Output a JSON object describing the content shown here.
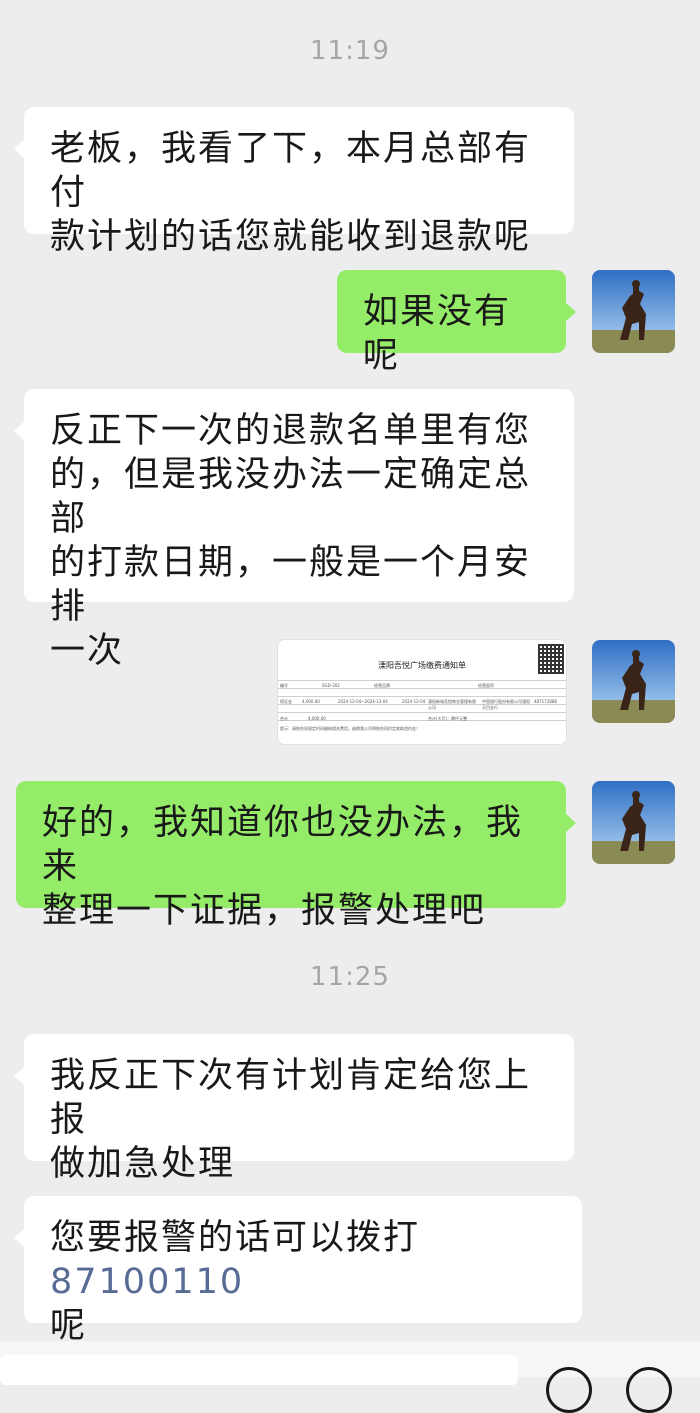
{
  "timestamps": [
    "11:19",
    "11:25"
  ],
  "messages": [
    {
      "side": "left",
      "text_lines": [
        "老板，我看了下，本月总部有付",
        "款计划的话您就能收到退款呢"
      ]
    },
    {
      "side": "right",
      "text_lines": [
        "如果没有呢"
      ]
    },
    {
      "side": "left",
      "text_lines": [
        "反正下一次的退款名单里有您",
        "的，但是我没办法一定确定总部",
        "的打款日期，一般是一个月安排",
        "一次"
      ]
    },
    {
      "side": "right",
      "type": "image",
      "image": {
        "title": "溧阳吾悦广场缴费通知单",
        "cells": [
          "编号",
          "SGD-302",
          "经营品牌",
          "经营面积",
          "保证金",
          "4,000.00",
          "2024-12-04~2024-12-04",
          "2024-12-04",
          "溧阳新城吾悦商业管理有限公司",
          "中国银行股份有限公司溧阳天目支行",
          "487172888",
          "合计",
          "4,000.00",
          "合计(大写)：肆仟元整",
          "提示：请按合同规定时间缴纳相关费用，逾期我公司将按合同约定收取违约金！"
        ]
      }
    },
    {
      "side": "right",
      "text_lines": [
        "好的，我知道你也没办法，我来",
        "整理一下证据，报警处理吧"
      ]
    },
    {
      "side": "left",
      "text_lines": [
        "我反正下次有计划肯定给您上报",
        "做加急处理"
      ]
    },
    {
      "side": "left",
      "text_lines": [
        "您要报警的话可以拨打",
        "呢"
      ],
      "phone": "87100110"
    }
  ],
  "avatar_icon": "user-avatar-horse-rider-icon",
  "input_bar": {
    "voice_icon": "voice-icon",
    "emoji_icon": "emoji-icon",
    "plus_icon": "plus-icon"
  },
  "colors": {
    "background": "#ededed",
    "sent_bubble": "#95ec69",
    "received_bubble": "#ffffff",
    "link": "#576b95"
  }
}
